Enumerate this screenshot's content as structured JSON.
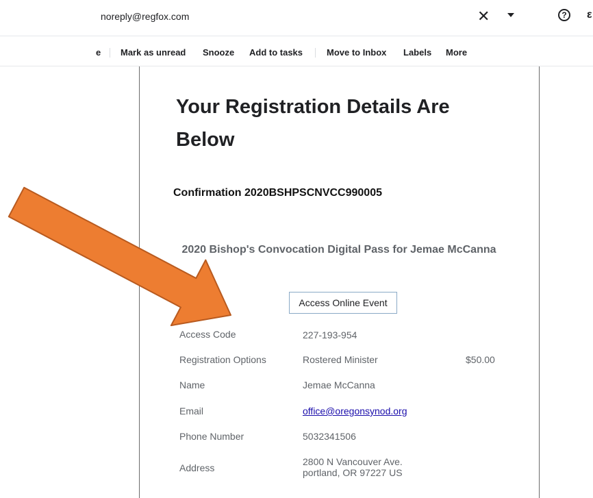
{
  "header": {
    "sender": "noreply@regfox.com",
    "close_glyph": "✕",
    "help_glyph": "?",
    "extra_glyph": "ε"
  },
  "toolbar": {
    "partial_label": "e",
    "mark_unread": "Mark as unread",
    "snooze": "Snooze",
    "add_tasks": "Add to tasks",
    "move_inbox": "Move to Inbox",
    "labels": "Labels",
    "more": "More"
  },
  "email": {
    "heading": "Your Registration Details Are Below",
    "confirmation": "Confirmation 2020BSHPSCNVCC990005",
    "pass_title": "2020 Bishop's Convocation Digital Pass for Jemae McCanna",
    "access_button": "Access Online Event",
    "details": [
      {
        "label": "Access Code",
        "value": "227-193-954"
      },
      {
        "label": "Registration Options",
        "value": "Rostered Minister",
        "price": "$50.00"
      },
      {
        "label": "Name",
        "value": "Jemae McCanna"
      },
      {
        "label": "Email",
        "value": "office@oregonsynod.org"
      },
      {
        "label": "Phone Number",
        "value": "5032341506"
      },
      {
        "label": "Address",
        "value_line1": "2800 N Vancouver Ave.",
        "value_line2": "portland, OR 97227 US"
      }
    ]
  },
  "annotation": {
    "arrow_color": "#ed7d31",
    "arrow_outline": "#b85a1f"
  }
}
